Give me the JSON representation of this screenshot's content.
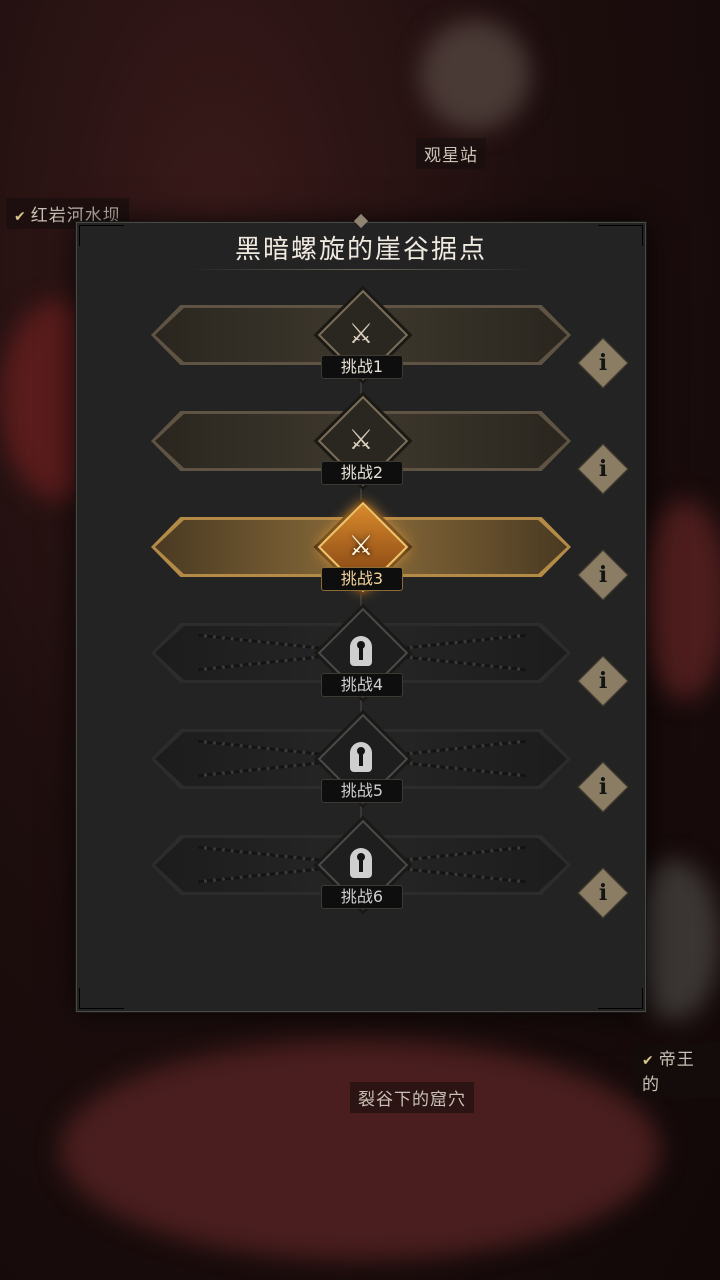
{
  "map": {
    "locations": [
      {
        "name": "观星站",
        "completed": false
      },
      {
        "name": "红岩河水坝",
        "completed": true
      },
      {
        "name": "帝王的",
        "completed": true
      },
      {
        "name": "裂谷下的窟穴",
        "completed": false
      }
    ]
  },
  "dialog": {
    "title": "黑暗螺旋的崖谷据点",
    "challenges": [
      {
        "label": "挑战1",
        "state": "completed",
        "icon": "swords-sheathed-icon"
      },
      {
        "label": "挑战2",
        "state": "completed",
        "icon": "swords-sheathed-icon"
      },
      {
        "label": "挑战3",
        "state": "current",
        "icon": "crossed-swords-icon"
      },
      {
        "label": "挑战4",
        "state": "locked",
        "icon": "keyhole-lock-icon"
      },
      {
        "label": "挑战5",
        "state": "locked",
        "icon": "keyhole-lock-icon"
      },
      {
        "label": "挑战6",
        "state": "locked",
        "icon": "keyhole-lock-icon"
      }
    ],
    "info_glyph": "i"
  },
  "colors": {
    "dialog_bg": "#232323",
    "accent_gold": "#b38a46",
    "active_glow": "#e59b36"
  }
}
